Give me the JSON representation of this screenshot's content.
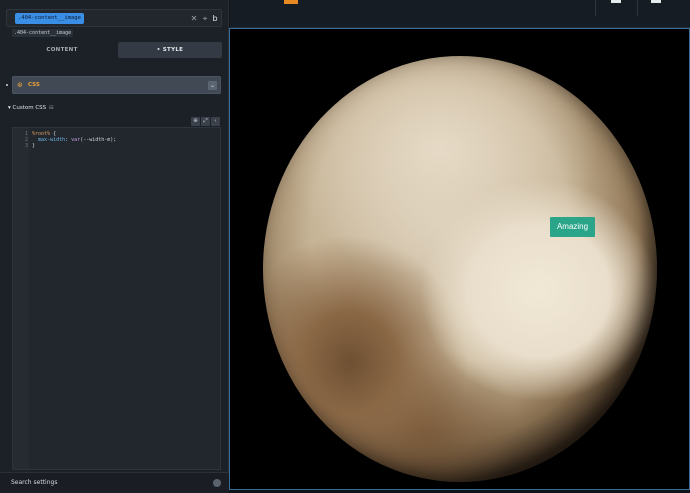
{
  "editor_panel": {
    "selector_chip": ".404-content__image",
    "selector_suffix": "b",
    "sub_chip": ".404-content__image",
    "tabs": [
      {
        "label": "CONTENT",
        "active": false
      },
      {
        "label": "• STYLE",
        "active": true
      }
    ],
    "section": {
      "label": "CSS",
      "icon": "css-icon"
    },
    "custom_css_label": "Custom CSS",
    "code_lines": [
      {
        "n": "1",
        "parts": [
          [
            "c-sel",
            "%root%"
          ],
          [
            "c-punc",
            " {"
          ]
        ]
      },
      {
        "n": "2",
        "parts": [
          [
            "c-punc",
            "  "
          ],
          [
            "c-prop",
            "max-width"
          ],
          [
            "c-punc",
            ": "
          ],
          [
            "c-val",
            "var"
          ],
          [
            "c-punc",
            "(--width-m);"
          ]
        ]
      },
      {
        "n": "3",
        "parts": [
          [
            "c-punc",
            "}"
          ]
        ]
      }
    ],
    "search_placeholder": "Search settings"
  },
  "canvas": {
    "badge_label": "Amazing"
  },
  "colors": {
    "accent": "#3a8ee6",
    "badge": "#2aa58a",
    "css_label": "#e8a33a"
  }
}
